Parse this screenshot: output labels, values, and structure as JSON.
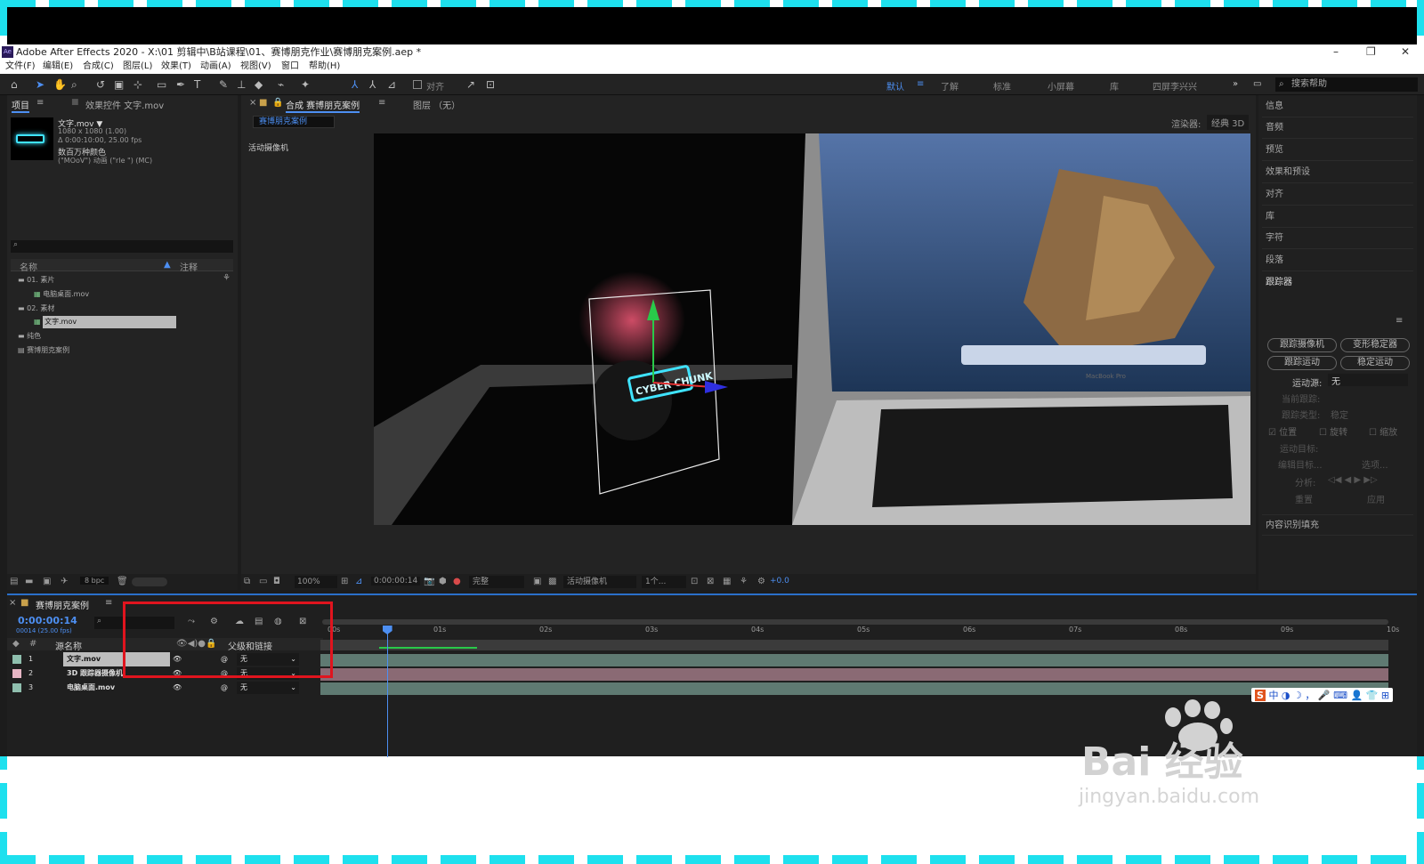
{
  "window": {
    "title": "Adobe After Effects 2020 - X:\\01 剪辑中\\B站课程\\01、赛博朋克作业\\赛博朋克案例.aep *",
    "logo": "Ae"
  },
  "menu": [
    "文件(F)",
    "编辑(E)",
    "合成(C)",
    "图层(L)",
    "效果(T)",
    "动画(A)",
    "视图(V)",
    "窗口",
    "帮助(H)"
  ],
  "toolbar": {
    "align_label": "对齐",
    "workspaces": [
      "默认",
      "了解",
      "标准",
      "小屏幕",
      "库",
      "四屏李兴兴"
    ],
    "search_placeholder": "搜索帮助"
  },
  "project": {
    "tab_project": "项目",
    "tab_effects": "效果控件 文字.mov",
    "file_name": "文字.mov ▼",
    "file_info": [
      "1080 x 1080 (1.00)",
      "Δ 0:00:10:00, 25.00 fps",
      "数百万种颜色",
      "(\"MOoV\") 动画 (\"rle \") (MC)"
    ],
    "col_name": "名称",
    "col_comment": "注释",
    "items": [
      {
        "label": "01. 素片",
        "type": "folder"
      },
      {
        "label": "电脑桌面.mov",
        "type": "file"
      },
      {
        "label": "02. 素材",
        "type": "folder"
      },
      {
        "label": "文字.mov",
        "type": "file",
        "selected": true
      },
      {
        "label": "纯色",
        "type": "folder"
      },
      {
        "label": "赛博朋克案例",
        "type": "comp"
      }
    ],
    "bpc": "8 bpc"
  },
  "comp": {
    "tab": "合成 赛博朋克案例",
    "tab_layer": "图层 （无）",
    "comp_chip": "赛博朋克案例",
    "renderer_label": "渲染器:",
    "renderer_value": "经典 3D",
    "camera_label": "活动摄像机",
    "bottom": {
      "zoom": "100%",
      "time": "0:00:00:14",
      "quality": "完整",
      "camera": "活动摄像机",
      "views": "1个...",
      "exposure": "+0.0"
    },
    "neon_text": "CYBER CHUNK",
    "laptop_brand": "MacBook Pro"
  },
  "right_panel": {
    "items": [
      "信息",
      "音频",
      "预览",
      "效果和预设",
      "对齐",
      "库",
      "字符",
      "段落"
    ],
    "tracker": {
      "title": "跟踪器",
      "buttons": [
        "跟踪摄像机",
        "变形稳定器",
        "跟踪运动",
        "稳定运动"
      ],
      "motion_source_label": "运动源:",
      "motion_source_value": "无",
      "current_track": "当前跟踪:",
      "track_type": "跟踪类型:",
      "track_type_value": "稳定",
      "checkboxes": [
        "位置",
        "旋转",
        "缩放"
      ],
      "motion_target": "运动目标:",
      "edit_target": "编辑目标...",
      "options": "选项...",
      "analyze": "分析:",
      "reset": "重置",
      "apply": "应用"
    },
    "content_aware": "内容识别填充"
  },
  "timeline": {
    "tab": "赛博朋克案例",
    "time": "0:00:00:14",
    "fps": "00014 (25.00 fps)",
    "col_source": "源名称",
    "col_parent": "父级和链接",
    "layers": [
      {
        "num": "1",
        "name": "文字.mov",
        "parent": "无",
        "color": "#8fbfae"
      },
      {
        "num": "2",
        "name": "3D 跟踪器摄像机",
        "parent": "无",
        "color": "#e6b5c4"
      },
      {
        "num": "3",
        "name": "电脑桌面.mov",
        "parent": "无",
        "color": "#8fbfae"
      }
    ],
    "ruler": [
      "00s",
      "01s",
      "02s",
      "03s",
      "04s",
      "05s",
      "06s",
      "07s",
      "08s",
      "09s",
      "10s"
    ],
    "playhead_fraction": 0.056
  },
  "ime_bar": "中 ◑ ☽ ， 🎤 ⌨ 👤 👕 ⊞",
  "watermark": {
    "brand": "Bai 经验",
    "url": "jingyan.baidu.com"
  }
}
